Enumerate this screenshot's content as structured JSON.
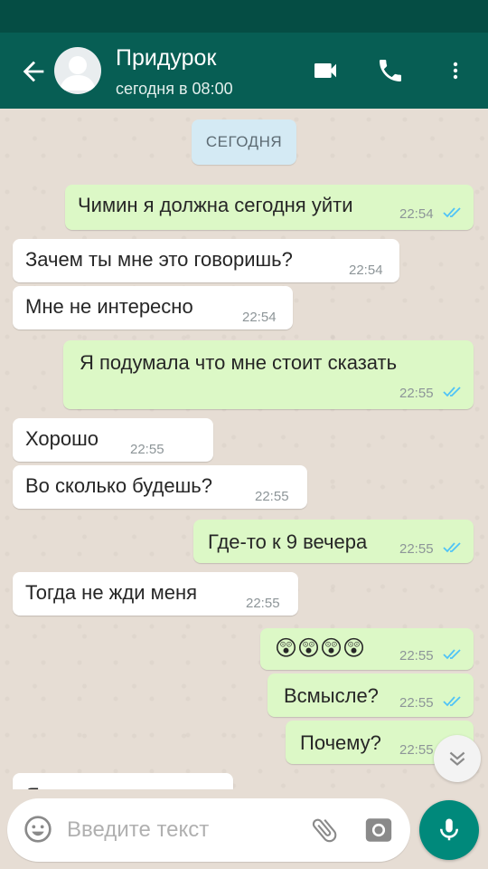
{
  "header": {
    "contact_name": "Придурок",
    "status": "сегодня в 08:00"
  },
  "chat": {
    "date_chip": "СЕГОДНЯ",
    "messages": [
      {
        "dir": "out",
        "text": "Чимин я должна сегодня уйти",
        "time": "22:54",
        "read": true
      },
      {
        "dir": "in",
        "text": "Зачем ты мне это говоришь?",
        "time": "22:54"
      },
      {
        "dir": "in",
        "text": "Мне не интересно",
        "time": "22:54"
      },
      {
        "dir": "out",
        "text": "Я подумала что мне стоит сказать",
        "time": "22:55",
        "read": true
      },
      {
        "dir": "in",
        "text": "Хорошо",
        "time": "22:55"
      },
      {
        "dir": "in",
        "text": "Во сколько будешь?",
        "time": "22:55"
      },
      {
        "dir": "out",
        "text": "Где-то к 9 вечера",
        "time": "22:55",
        "read": true
      },
      {
        "dir": "in",
        "text": "Тогда не жди меня",
        "time": "22:55"
      },
      {
        "dir": "out",
        "text": "😲😲😲😲",
        "time": "22:55",
        "read": true
      },
      {
        "dir": "out",
        "text": "Всмысле?",
        "time": "22:55",
        "read": true
      },
      {
        "dir": "out",
        "text": "Почему?",
        "time": "22:55",
        "read": true
      },
      {
        "dir": "in",
        "text": "Я",
        "time": ""
      }
    ]
  },
  "input": {
    "placeholder": "Введите текст"
  },
  "colors": {
    "header": "#075e54",
    "statusbar": "#054d44",
    "outgoing_bubble": "#dcf8c6",
    "incoming_bubble": "#ffffff",
    "read_ticks": "#4fc3f7",
    "mic_button": "#00897b"
  },
  "icons": {
    "back": "arrow-left-icon",
    "video": "video-camera-icon",
    "call": "phone-icon",
    "menu": "more-vert-icon",
    "emoji": "smiley-icon",
    "attach": "paperclip-icon",
    "camera": "camera-icon",
    "mic": "microphone-icon",
    "scroll": "double-chevron-down-icon"
  }
}
